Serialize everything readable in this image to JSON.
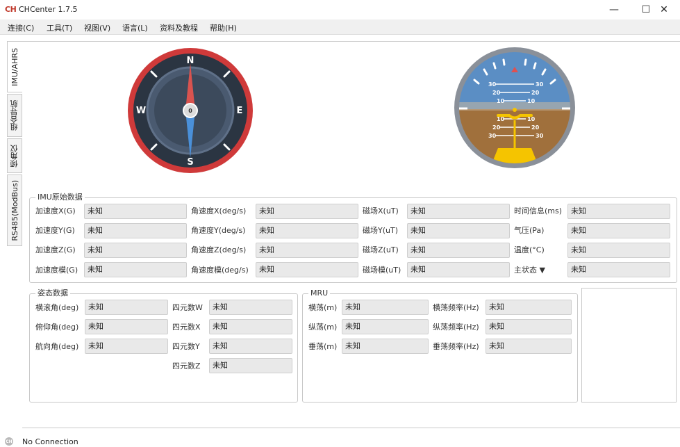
{
  "window": {
    "icon_text": "CH",
    "title": "CHCenter 1.7.5",
    "min_glyph": "—",
    "max_glyph": "☐",
    "close_glyph": "✕"
  },
  "menu": [
    "连接(C)",
    "工具(T)",
    "视图(V)",
    "语言(L)",
    "资料及教程",
    "帮助(H)"
  ],
  "tabs": [
    "IMU/AHRS",
    "组合导航",
    "倾角仪",
    "RS485(ModBus)"
  ],
  "compass": {
    "north": "N",
    "east": "E",
    "south": "S",
    "west": "W",
    "heading": "0",
    "colors": {
      "rim": "#cf3a3a",
      "face": "#3a4656",
      "needle_north": "#d9534f",
      "needle_south": "#4a90d9"
    }
  },
  "attitude_indicator": {
    "pitch_marks": [
      "30",
      "20",
      "10",
      "10",
      "20",
      "30"
    ],
    "colors": {
      "sky": "#5b8ec4",
      "ground": "#a0703c",
      "bezel": "#8a9099",
      "symbol": "#f5c400"
    }
  },
  "imu_raw": {
    "title": "IMU原始数据",
    "rows": [
      [
        {
          "label": "加速度X(G)",
          "value": "未知"
        },
        {
          "label": "角速度X(deg/s)",
          "value": "未知"
        },
        {
          "label": "磁场X(uT)",
          "value": "未知"
        },
        {
          "label": "时间信息(ms)",
          "value": "未知"
        }
      ],
      [
        {
          "label": "加速度Y(G)",
          "value": "未知"
        },
        {
          "label": "角速度Y(deg/s)",
          "value": "未知"
        },
        {
          "label": "磁场Y(uT)",
          "value": "未知"
        },
        {
          "label": "气压(Pa)",
          "value": "未知"
        }
      ],
      [
        {
          "label": "加速度Z(G)",
          "value": "未知"
        },
        {
          "label": "角速度Z(deg/s)",
          "value": "未知"
        },
        {
          "label": "磁场Z(uT)",
          "value": "未知"
        },
        {
          "label": "温度(°C)",
          "value": "未知"
        }
      ],
      [
        {
          "label": "加速度模(G)",
          "value": "未知"
        },
        {
          "label": "角速度模(deg/s)",
          "value": "未知"
        },
        {
          "label": "磁场模(uT)",
          "value": "未知"
        },
        {
          "label": "主状态 ▼",
          "value": "未知"
        }
      ]
    ]
  },
  "attitude": {
    "title": "姿态数据",
    "left": [
      {
        "label": "横滚角(deg)",
        "value": "未知"
      },
      {
        "label": "俯仰角(deg)",
        "value": "未知"
      },
      {
        "label": "航向角(deg)",
        "value": "未知"
      }
    ],
    "right": [
      {
        "label": "四元数W",
        "value": "未知"
      },
      {
        "label": "四元数X",
        "value": "未知"
      },
      {
        "label": "四元数Y",
        "value": "未知"
      },
      {
        "label": "四元数Z",
        "value": "未知"
      }
    ]
  },
  "mru": {
    "title": "MRU",
    "left": [
      {
        "label": "横荡(m)",
        "value": "未知"
      },
      {
        "label": "纵荡(m)",
        "value": "未知"
      },
      {
        "label": "垂荡(m)",
        "value": "未知"
      }
    ],
    "right": [
      {
        "label": "横荡频率(Hz)",
        "value": "未知"
      },
      {
        "label": "纵荡频率(Hz)",
        "value": "未知"
      },
      {
        "label": "垂荡频率(Hz)",
        "value": "未知"
      }
    ]
  },
  "status": {
    "icon_text": "CH",
    "text": "No Connection"
  }
}
